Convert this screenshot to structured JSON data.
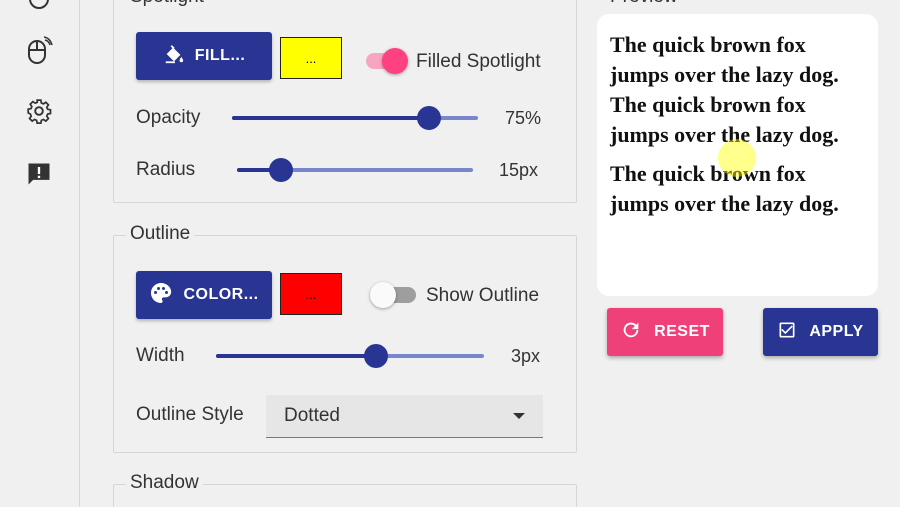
{
  "rail": {
    "icons": [
      "mouse-icon",
      "settings-gear-icon",
      "feedback-icon"
    ]
  },
  "spotlight": {
    "legend": "Spotlight",
    "fill_button": "FILL...",
    "color_swatch": {
      "label": "...",
      "color": "#ffff00"
    },
    "toggle": {
      "label": "Filled Spotlight",
      "on": true
    },
    "opacity": {
      "label": "Opacity",
      "value": "75%",
      "fraction": 0.8
    },
    "radius": {
      "label": "Radius",
      "value": "15px",
      "fraction": 0.19
    }
  },
  "outline": {
    "legend": "Outline",
    "color_button": "COLOR...",
    "color_swatch": {
      "label": "...",
      "color": "#ff0000"
    },
    "toggle": {
      "label": "Show Outline",
      "on": false
    },
    "width": {
      "label": "Width",
      "value": "3px",
      "fraction": 0.59
    },
    "style": {
      "label": "Outline Style",
      "selected": "Dotted"
    }
  },
  "shadow": {
    "legend": "Shadow"
  },
  "preview": {
    "title": "Preview",
    "paragraphs": [
      "The quick brown fox jumps over the lazy dog.",
      "The quick brown fox jumps over the lazy dog.",
      "The quick brown fox jumps over the lazy dog."
    ]
  },
  "actions": {
    "reset": "RESET",
    "apply": "APPLY"
  },
  "colors": {
    "primary": "#283593",
    "accent": "#ff4081",
    "pink_button": "#f0407a"
  }
}
